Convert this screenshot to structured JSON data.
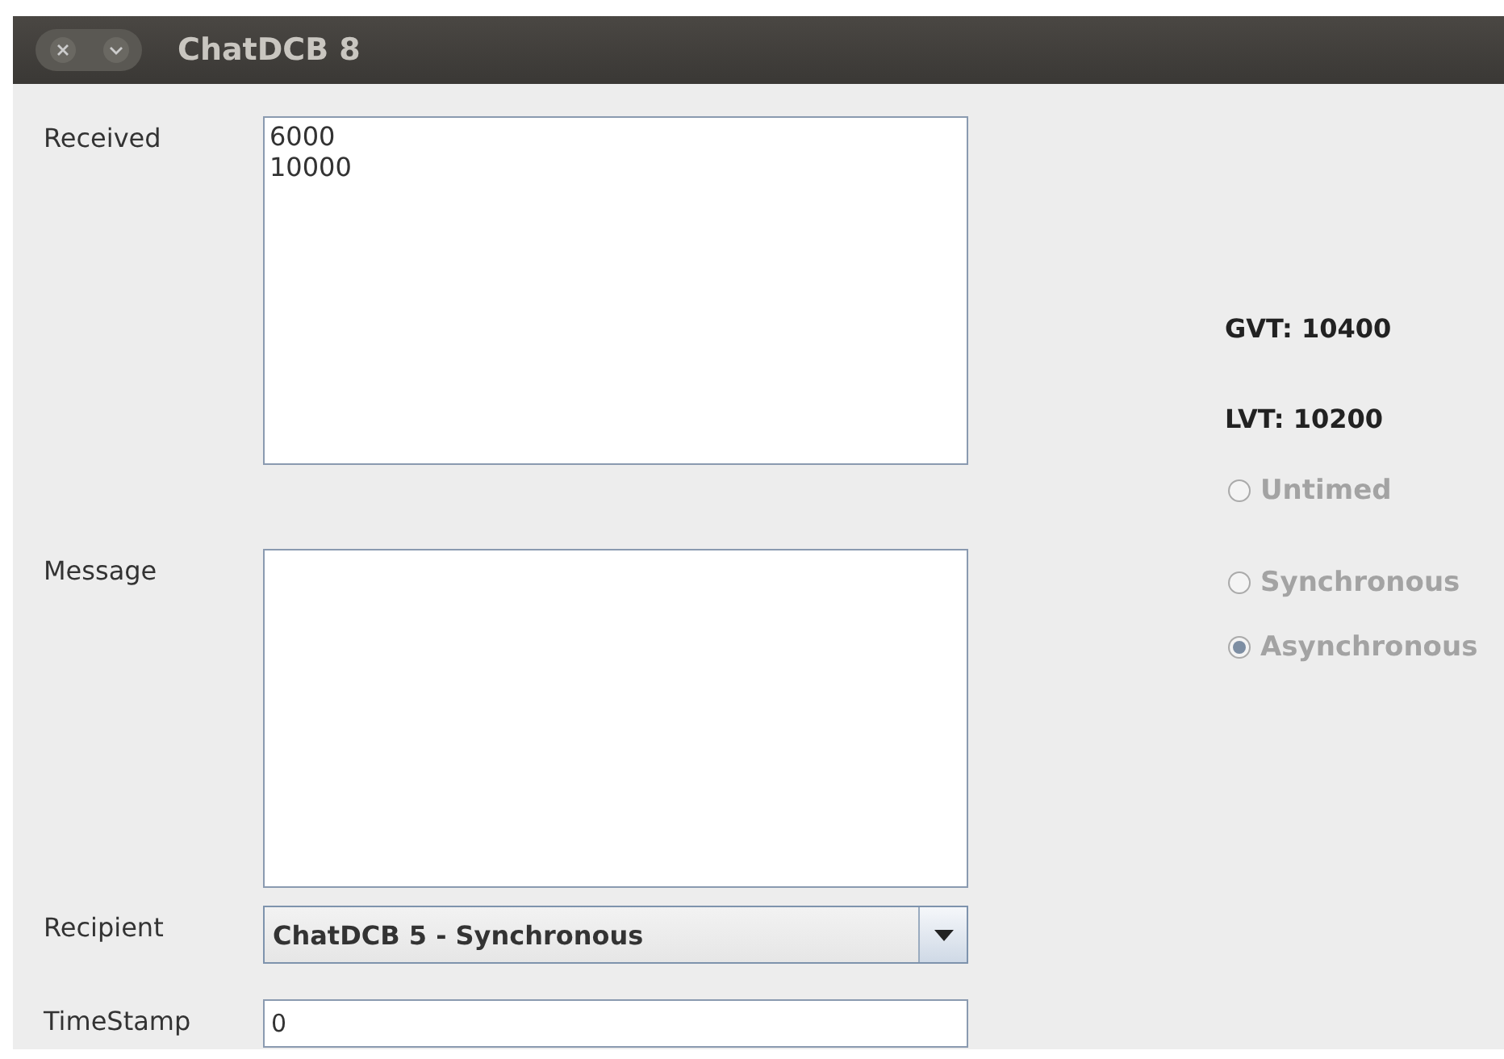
{
  "window": {
    "title": "ChatDCB 8"
  },
  "received": {
    "label": "Received",
    "lines": [
      "6000",
      "10000"
    ]
  },
  "message": {
    "label": "Message"
  },
  "recipient": {
    "label": "Recipient",
    "value": "ChatDCB 5 - Synchronous"
  },
  "timestamp": {
    "label": "TimeStamp",
    "value": "0"
  },
  "gvt": "GVT: 10400",
  "lvt": "LVT: 10200",
  "modes": [
    {
      "label": "Untimed",
      "selected": false,
      "disabled": true
    },
    {
      "label": "Synchronous",
      "selected": false,
      "disabled": true
    },
    {
      "label": "Asynchronous",
      "selected": true,
      "disabled": true
    }
  ]
}
